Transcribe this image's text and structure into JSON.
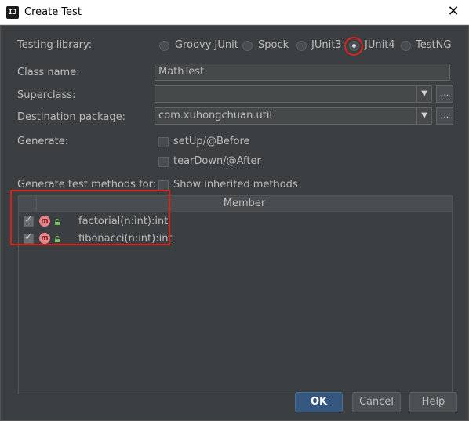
{
  "window": {
    "title": "Create Test",
    "app_icon": "ij-logo-icon",
    "app_icon_text": "IJ",
    "close_label": "✕"
  },
  "form": {
    "testing_library_label": "Testing library:",
    "libraries": [
      {
        "label": "Groovy JUnit",
        "selected": false
      },
      {
        "label": "Spock",
        "selected": false
      },
      {
        "label": "JUnit3",
        "selected": false
      },
      {
        "label": "JUnit4",
        "selected": true
      },
      {
        "label": "TestNG",
        "selected": false
      }
    ],
    "class_name_label": "Class name:",
    "class_name_value": "MathTest",
    "superclass_label": "Superclass:",
    "superclass_value": "",
    "destination_label": "Destination package:",
    "destination_value": "com.xuhongchuan.util",
    "generate_label": "Generate:",
    "setup_label": "setUp/@Before",
    "teardown_label": "tearDown/@After",
    "methods_for_label": "Generate test methods for:",
    "show_inherited_label": "Show inherited methods",
    "dropdown_arrow": "▼",
    "browse_label": "..."
  },
  "table": {
    "header_member": "Member",
    "method_icon_text": "m",
    "rows": [
      {
        "label": "factorial(n:int):int",
        "checked": true
      },
      {
        "label": "fibonacci(n:int):int",
        "checked": true
      }
    ]
  },
  "buttons": {
    "ok": "OK",
    "cancel": "Cancel",
    "help": "Help"
  },
  "colors": {
    "background": "#3c3f41",
    "accent": "#365880",
    "highlight": "#d9211e",
    "method_icon": "#e8858a"
  }
}
